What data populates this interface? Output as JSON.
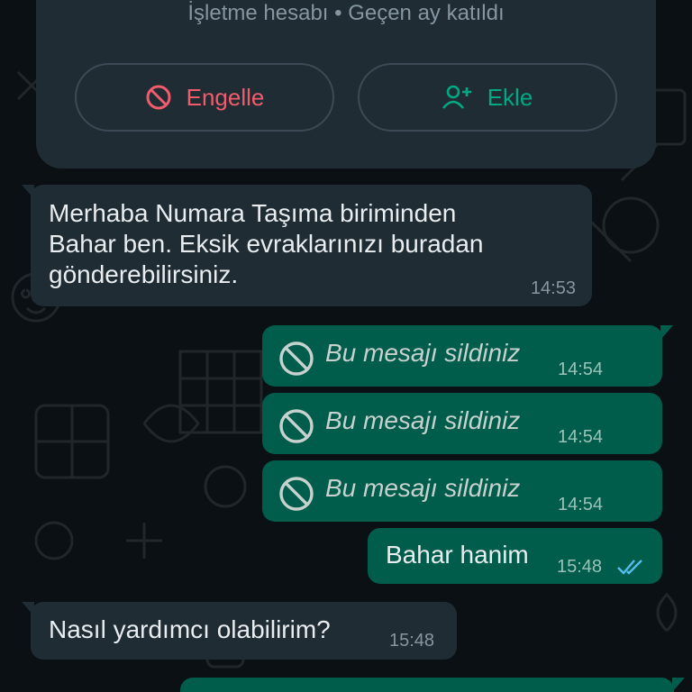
{
  "contact_card": {
    "subtitle": "İşletme hesabı • Geçen ay katıldı",
    "block_label": "Engelle",
    "add_label": "Ekle"
  },
  "messages": [
    {
      "direction": "incoming",
      "text": "Merhaba Numara Taşıma biriminden\nBahar ben. Eksik evraklarınızı buradan\ngönderebilirsiniz.",
      "time": "14:53"
    },
    {
      "direction": "outgoing",
      "deleted": true,
      "text": "Bu mesajı sildiniz",
      "time": "14:54"
    },
    {
      "direction": "outgoing",
      "deleted": true,
      "text": "Bu mesajı sildiniz",
      "time": "14:54"
    },
    {
      "direction": "outgoing",
      "deleted": true,
      "text": "Bu mesajı sildiniz",
      "time": "14:54"
    },
    {
      "direction": "outgoing",
      "text": "Bahar hanim",
      "time": "15:48",
      "status": "read"
    },
    {
      "direction": "incoming",
      "text": "Nasıl yardımcı olabilirim?",
      "time": "15:48"
    }
  ],
  "colors": {
    "background": "#0b1014",
    "incoming_bubble": "#1f2c34",
    "outgoing_bubble": "#005c4b",
    "block_red": "#f15c6d",
    "add_green": "#00a884",
    "read_ticks": "#53bdeb"
  },
  "icons": {
    "block": "block-icon",
    "add_contact": "add-contact-icon",
    "deleted": "deleted-message-icon",
    "read_receipt": "double-check-icon"
  }
}
